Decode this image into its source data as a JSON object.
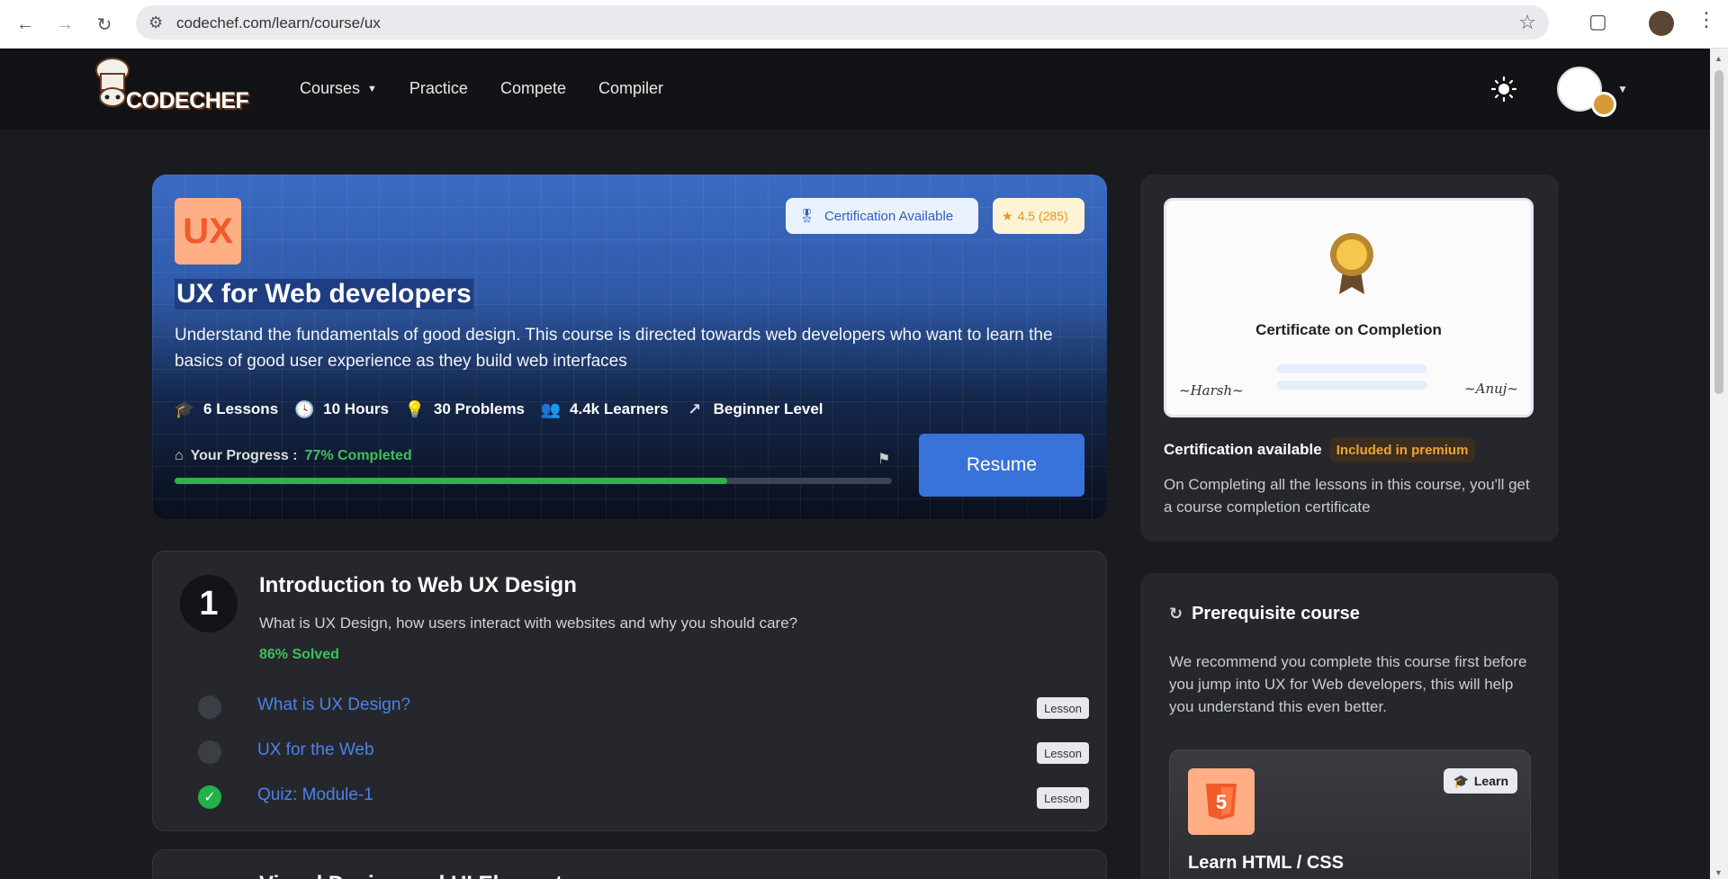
{
  "browser": {
    "url": "codechef.com/learn/course/ux",
    "icons": {
      "back": "arrow-left-icon",
      "forward": "arrow-right-icon",
      "reload": "reload-icon",
      "site_info": "site-info-icon",
      "bookmark": "star-icon",
      "extensions": "puzzle-icon",
      "menu": "kebab-menu-icon"
    }
  },
  "header": {
    "logo_text": "CODECHEF",
    "nav": [
      {
        "label": "Courses",
        "has_dropdown": true
      },
      {
        "label": "Practice"
      },
      {
        "label": "Compete"
      },
      {
        "label": "Compiler"
      }
    ],
    "icons": {
      "theme": "sun-icon",
      "avatar": "chef-avatar-icon"
    }
  },
  "hero": {
    "badge": "UX",
    "certification_label": "Certification Available",
    "rating": "4.5 (285)",
    "title": "UX for Web developers",
    "description": "Understand the fundamentals of good design. This course is directed towards web developers who want to learn the basics of good user experience as they build web interfaces",
    "stats": [
      {
        "icon": "graduation-cap-icon",
        "label": "6 Lessons"
      },
      {
        "icon": "clock-icon",
        "label": "10 Hours"
      },
      {
        "icon": "bulb-icon",
        "label": "30 Problems"
      },
      {
        "icon": "users-icon",
        "label": "4.4k Learners"
      },
      {
        "icon": "trend-up-icon",
        "label": "Beginner Level"
      }
    ],
    "progress_label": "Your Progress :",
    "progress_value": "77% Completed",
    "progress_fraction": 0.77,
    "resume_label": "Resume",
    "colors": {
      "accent": "#3873d9",
      "progress": "#2fb24a"
    }
  },
  "module1": {
    "number": "1",
    "title": "Introduction to Web UX Design",
    "description": "What is UX Design, how users interact with websites and why you should care?",
    "solved": "86% Solved",
    "lessons": [
      {
        "title": "What is UX Design?",
        "tag": "Lesson",
        "done": false
      },
      {
        "title": "UX for the Web",
        "tag": "Lesson",
        "done": false
      },
      {
        "title": "Quiz: Module-1",
        "tag": "Lesson",
        "done": true
      }
    ]
  },
  "module2": {
    "title": "Visual Design and UI Elements"
  },
  "certificate": {
    "preview_title": "Certificate on Completion",
    "available_label": "Certification available",
    "premium_label": "Included in premium",
    "description": "On Completing all the lessons in this course, you'll get a course completion certificate"
  },
  "prereq": {
    "title": "Prerequisite course",
    "description": "We recommend you complete this course first before you jump into UX for Web developers, this will help you understand this even better.",
    "course": {
      "title": "Learn HTML / CSS",
      "pill": "Learn"
    }
  }
}
